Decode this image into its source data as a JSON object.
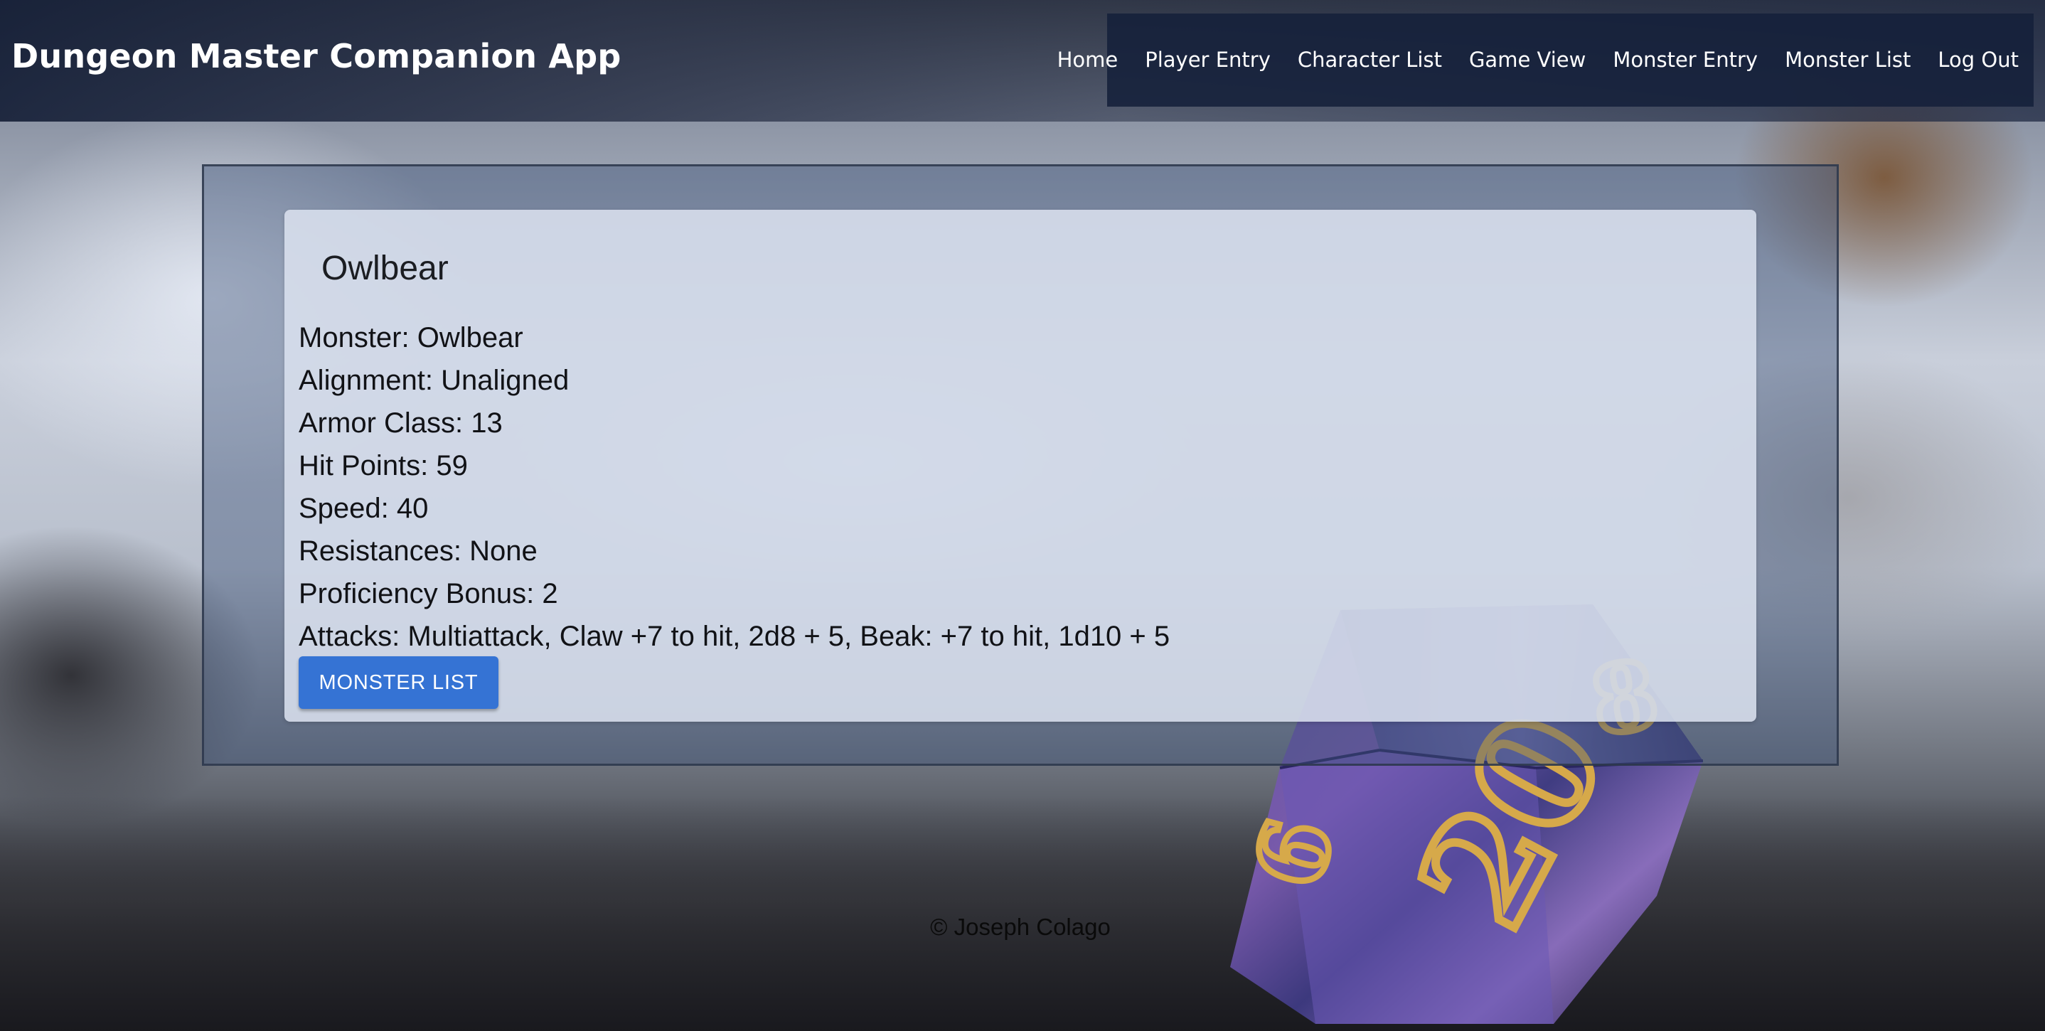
{
  "header": {
    "app_title": "Dungeon Master Companion App",
    "nav": [
      "Home",
      "Player Entry",
      "Character List",
      "Game View",
      "Monster Entry",
      "Monster List",
      "Log Out"
    ]
  },
  "monster": {
    "title": "Owlbear",
    "stats": [
      "Monster: Owlbear",
      "Alignment: Unaligned",
      "Armor Class: 13",
      "Hit Points: 59",
      "Speed: 40",
      "Resistances: None",
      "Proficiency Bonus: 2",
      "Attacks: Multiattack, Claw +7 to hit, 2d8 + 5, Beak: +7 to hit, 1d10 + 5"
    ],
    "button_label": "MONSTER LIST"
  },
  "footer": {
    "copyright": "© Joseph Colago"
  },
  "background": {
    "image": "d20-die-icon",
    "die_face_numbers": [
      "20",
      "8",
      "6"
    ]
  },
  "colors": {
    "header_bg": "#162038",
    "button_bg": "#3573d4"
  }
}
